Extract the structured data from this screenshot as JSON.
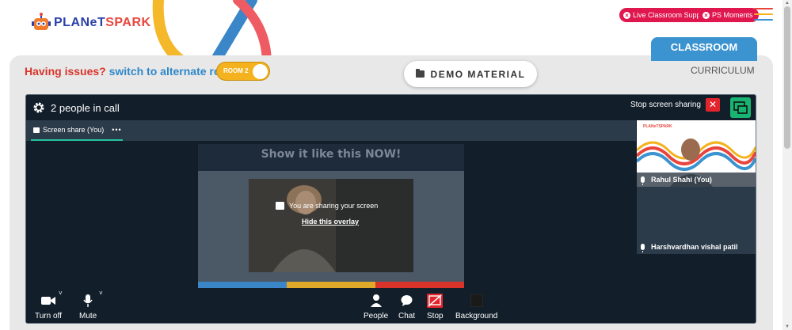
{
  "brand": {
    "logo_part1": "PLANeT",
    "logo_part2": "SPARK"
  },
  "header": {
    "live_support": "Live Classroom Support",
    "ps_moments": "PS Moments"
  },
  "tabs": {
    "classroom": "CLASSROOM",
    "curriculum": "CURRICULUM"
  },
  "issues": {
    "question": "Having issues?",
    "switch_text": "switch to alternate room",
    "room_toggle": "ROOM 2"
  },
  "demo_material": "DEMO MATERIAL",
  "call": {
    "people_count": "2 people in call",
    "stop_sharing": "Stop screen sharing",
    "screen_share_tab": "Screen share (You)",
    "more": "•••",
    "slide_title": "Show it like this NOW!",
    "sharing_message": "You are sharing your screen",
    "hide_overlay": "Hide this overlay",
    "participants": [
      {
        "name": "Rahul Shahi (You)"
      },
      {
        "name": "Harshvardhan vishal patil"
      }
    ],
    "toolbar": {
      "camera": "Turn off",
      "mute": "Mute",
      "people": "People",
      "chat": "Chat",
      "stop": "Stop",
      "background": "Background"
    }
  },
  "colors": {
    "accent_red": "#e0174e",
    "tab_blue": "#3b93d0",
    "toggle_yellow": "#f3b21e",
    "call_bg": "#121e2a",
    "pip_green": "#17b571"
  }
}
